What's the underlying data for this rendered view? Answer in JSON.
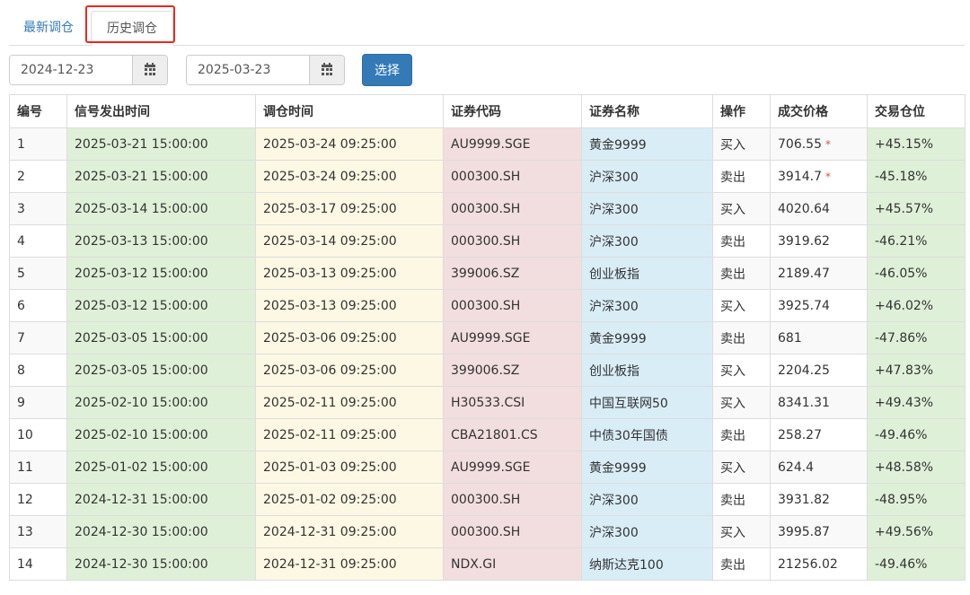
{
  "tabs": {
    "latest": "最新调仓",
    "history": "历史调仓"
  },
  "filters": {
    "start_date": "2024-12-23",
    "end_date": "2025-03-23",
    "select_label": "选择"
  },
  "table": {
    "headers": [
      "编号",
      "信号发出时间",
      "调仓时间",
      "证券代码",
      "证券名称",
      "操作",
      "成交价格",
      "交易仓位"
    ],
    "star_mark": "*",
    "rows": [
      {
        "id": "1",
        "signal_time": "2025-03-21 15:00:00",
        "rebalance_time": "2025-03-24 09:25:00",
        "code": "AU9999.SGE",
        "name": "黄金9999",
        "op": "买入",
        "price": "706.55",
        "star": true,
        "position": "+45.15%"
      },
      {
        "id": "2",
        "signal_time": "2025-03-21 15:00:00",
        "rebalance_time": "2025-03-24 09:25:00",
        "code": "000300.SH",
        "name": "沪深300",
        "op": "卖出",
        "price": "3914.7",
        "star": true,
        "position": "-45.18%"
      },
      {
        "id": "3",
        "signal_time": "2025-03-14 15:00:00",
        "rebalance_time": "2025-03-17 09:25:00",
        "code": "000300.SH",
        "name": "沪深300",
        "op": "买入",
        "price": "4020.64",
        "star": false,
        "position": "+45.57%"
      },
      {
        "id": "4",
        "signal_time": "2025-03-13 15:00:00",
        "rebalance_time": "2025-03-14 09:25:00",
        "code": "000300.SH",
        "name": "沪深300",
        "op": "卖出",
        "price": "3919.62",
        "star": false,
        "position": "-46.21%"
      },
      {
        "id": "5",
        "signal_time": "2025-03-12 15:00:00",
        "rebalance_time": "2025-03-13 09:25:00",
        "code": "399006.SZ",
        "name": "创业板指",
        "op": "卖出",
        "price": "2189.47",
        "star": false,
        "position": "-46.05%"
      },
      {
        "id": "6",
        "signal_time": "2025-03-12 15:00:00",
        "rebalance_time": "2025-03-13 09:25:00",
        "code": "000300.SH",
        "name": "沪深300",
        "op": "买入",
        "price": "3925.74",
        "star": false,
        "position": "+46.02%"
      },
      {
        "id": "7",
        "signal_time": "2025-03-05 15:00:00",
        "rebalance_time": "2025-03-06 09:25:00",
        "code": "AU9999.SGE",
        "name": "黄金9999",
        "op": "卖出",
        "price": "681",
        "star": false,
        "position": "-47.86%"
      },
      {
        "id": "8",
        "signal_time": "2025-03-05 15:00:00",
        "rebalance_time": "2025-03-06 09:25:00",
        "code": "399006.SZ",
        "name": "创业板指",
        "op": "买入",
        "price": "2204.25",
        "star": false,
        "position": "+47.83%"
      },
      {
        "id": "9",
        "signal_time": "2025-02-10 15:00:00",
        "rebalance_time": "2025-02-11 09:25:00",
        "code": "H30533.CSI",
        "name": "中国互联网50",
        "op": "买入",
        "price": "8341.31",
        "star": false,
        "position": "+49.43%"
      },
      {
        "id": "10",
        "signal_time": "2025-02-10 15:00:00",
        "rebalance_time": "2025-02-11 09:25:00",
        "code": "CBA21801.CS",
        "name": "中债30年国债",
        "op": "卖出",
        "price": "258.27",
        "star": false,
        "position": "-49.46%"
      },
      {
        "id": "11",
        "signal_time": "2025-01-02 15:00:00",
        "rebalance_time": "2025-01-03 09:25:00",
        "code": "AU9999.SGE",
        "name": "黄金9999",
        "op": "买入",
        "price": "624.4",
        "star": false,
        "position": "+48.58%"
      },
      {
        "id": "12",
        "signal_time": "2024-12-31 15:00:00",
        "rebalance_time": "2025-01-02 09:25:00",
        "code": "000300.SH",
        "name": "沪深300",
        "op": "卖出",
        "price": "3931.82",
        "star": false,
        "position": "-48.95%"
      },
      {
        "id": "13",
        "signal_time": "2024-12-30 15:00:00",
        "rebalance_time": "2024-12-31 09:25:00",
        "code": "000300.SH",
        "name": "沪深300",
        "op": "买入",
        "price": "3995.87",
        "star": false,
        "position": "+49.56%"
      },
      {
        "id": "14",
        "signal_time": "2024-12-30 15:00:00",
        "rebalance_time": "2024-12-31 09:25:00",
        "code": "NDX.GI",
        "name": "纳斯达克100",
        "op": "卖出",
        "price": "21256.02",
        "star": false,
        "position": "-49.46%"
      }
    ]
  },
  "colors": {
    "accent": "#337ab7",
    "highlight_border": "#e8281e",
    "signal_col": "#dff0d8",
    "time_col": "#fcf8e3",
    "code_col": "#f2dede",
    "name_col": "#d9edf7",
    "star": "#d9534f"
  }
}
